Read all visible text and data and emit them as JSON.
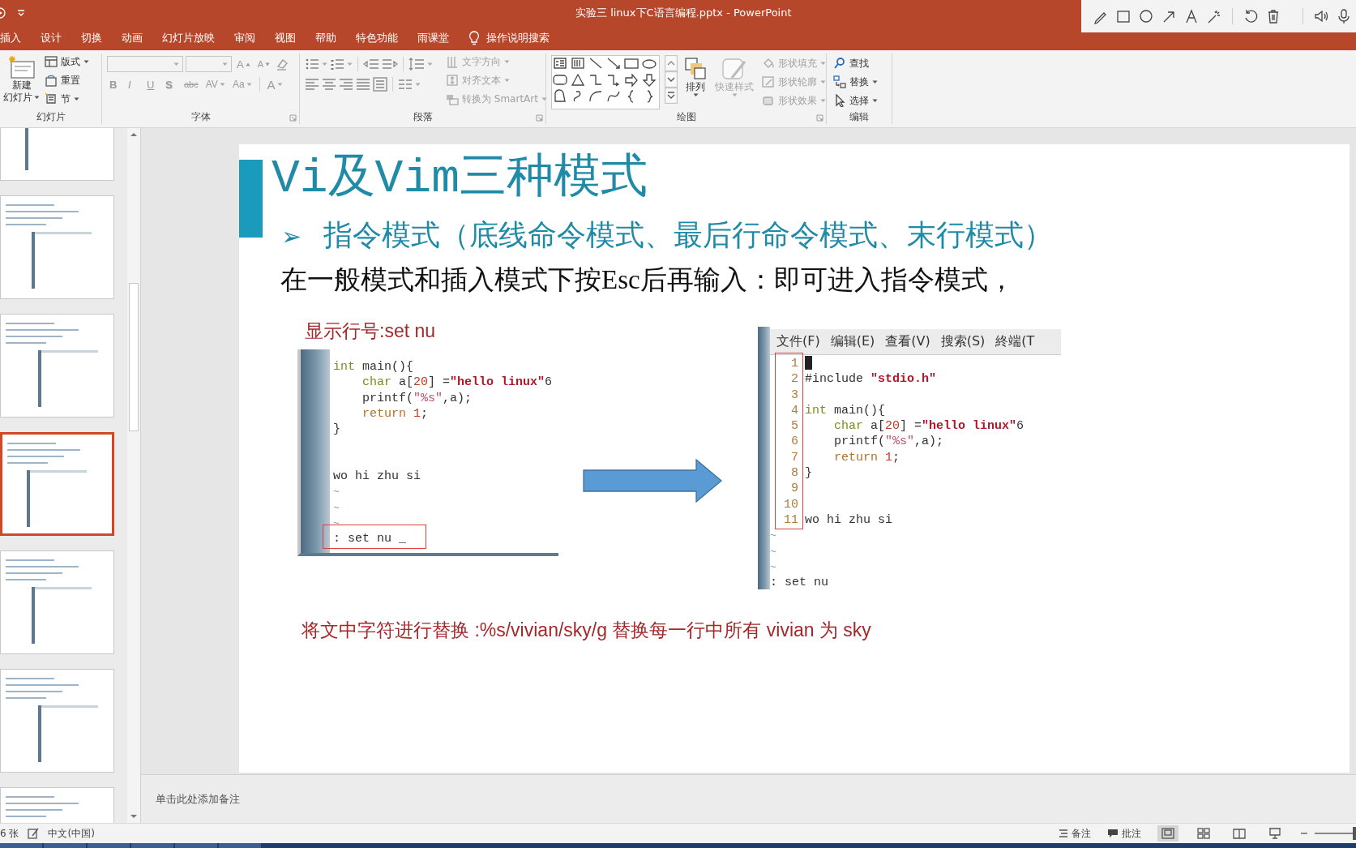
{
  "title_bar": {
    "title": "实验三  linux下C语言编程.pptx  -  PowerPoint"
  },
  "ribbon_tabs": [
    {
      "label": "插入",
      "selected": false
    },
    {
      "label": "设计",
      "selected": false
    },
    {
      "label": "切换",
      "selected": false
    },
    {
      "label": "动画",
      "selected": false
    },
    {
      "label": "幻灯片放映",
      "selected": false
    },
    {
      "label": "审阅",
      "selected": false
    },
    {
      "label": "视图",
      "selected": false
    },
    {
      "label": "帮助",
      "selected": false
    },
    {
      "label": "特色功能",
      "selected": false
    },
    {
      "label": "雨课堂",
      "selected": false
    }
  ],
  "tell_me": {
    "label": "操作说明搜索"
  },
  "ribbon": {
    "groups": [
      {
        "kind": "slides",
        "label": "幻灯片",
        "new_slide": {
          "label": "新建",
          "sublabel": "幻灯片"
        },
        "items": [
          {
            "label": "版式",
            "dropdown": true
          },
          {
            "label": "重置",
            "dropdown": false
          },
          {
            "label": "节",
            "dropdown": true
          }
        ]
      },
      {
        "kind": "font",
        "label": "字体",
        "disabled": true,
        "format_buttons": [
          "B",
          "I",
          "U",
          "S",
          "abc",
          "AV",
          "Aa"
        ],
        "grow_button": "A",
        "shrink_button": "A",
        "color_button": "A"
      },
      {
        "kind": "paragraph",
        "label": "段落",
        "items": [
          {
            "label": "文字方向",
            "disabled": true
          },
          {
            "label": "对齐文本",
            "disabled": true
          },
          {
            "label": "转换为 SmartArt",
            "disabled": true
          }
        ]
      },
      {
        "kind": "drawing",
        "label": "绘图",
        "arrange": {
          "label": "排列",
          "disabled": false
        },
        "quick_styles": {
          "label": "快速样式",
          "disabled": true
        },
        "items": [
          {
            "label": "形状填充",
            "disabled": true
          },
          {
            "label": "形状轮廓",
            "disabled": true
          },
          {
            "label": "形状效果",
            "disabled": true
          }
        ]
      },
      {
        "kind": "editing",
        "label": "编辑",
        "items": [
          {
            "label": "查找",
            "dropdown": false
          },
          {
            "label": "替换",
            "dropdown": true
          },
          {
            "label": "选择",
            "dropdown": true
          }
        ]
      }
    ]
  },
  "thumbnails": [
    {
      "selected": false
    },
    {
      "selected": false
    },
    {
      "selected": false
    },
    {
      "selected": true
    },
    {
      "selected": false
    },
    {
      "selected": false
    },
    {
      "selected": false
    }
  ],
  "slide": {
    "title": "Vi及Vim三种模式",
    "bullet_marker": "➢",
    "bullet": "指令模式（底线命令模式、最后行命令模式、末行模式）",
    "body": "在一般模式和插入模式下按Esc后再输入：即可进入指令模式，",
    "caption": "显示行号:set nu",
    "left_terminal": {
      "lines": [
        {
          "kind": "code",
          "tokens": [
            {
              "text": "int",
              "kind": "type"
            },
            {
              "text": " main(){",
              "kind": "plain"
            }
          ]
        },
        {
          "kind": "code",
          "tokens": [
            {
              "text": "    char",
              "kind": "type"
            },
            {
              "text": " a[",
              "kind": "plain"
            },
            {
              "text": "20",
              "kind": "number"
            },
            {
              "text": "] =",
              "kind": "plain"
            },
            {
              "text": "\"hello linux\"",
              "kind": "string"
            },
            {
              "text": "6",
              "kind": "plain"
            }
          ]
        },
        {
          "kind": "code",
          "tokens": [
            {
              "text": "    printf(",
              "kind": "plain"
            },
            {
              "text": "\"%s\"",
              "kind": "format"
            },
            {
              "text": ",a);",
              "kind": "plain"
            }
          ]
        },
        {
          "kind": "code",
          "tokens": [
            {
              "text": "    return",
              "kind": "keyword"
            },
            {
              "text": " 1",
              "kind": "number"
            },
            {
              "text": ";",
              "kind": "plain"
            }
          ]
        },
        {
          "kind": "code",
          "tokens": [
            {
              "text": "}",
              "kind": "plain"
            }
          ]
        },
        {
          "kind": "blank"
        },
        {
          "kind": "blank"
        },
        {
          "kind": "code",
          "tokens": [
            {
              "text": "wo hi zhu si",
              "kind": "plain"
            }
          ]
        },
        {
          "kind": "tilde",
          "text": "~"
        },
        {
          "kind": "tilde",
          "text": "~"
        },
        {
          "kind": "tilde",
          "text": "~"
        },
        {
          "kind": "command",
          "text": ": set nu _"
        }
      ]
    },
    "right_terminal": {
      "menu": [
        "文件(F)",
        "编辑(E)",
        "查看(V)",
        "搜索(S)",
        "終端(T"
      ],
      "lines": [
        {
          "kind": "code",
          "number": "1",
          "cursor": true
        },
        {
          "kind": "code",
          "number": "2",
          "cursor": false,
          "tokens": [
            {
              "text": "#include ",
              "kind": "plain"
            },
            {
              "text": "\"stdio.h\"",
              "kind": "string"
            }
          ]
        },
        {
          "kind": "blank",
          "number": "3",
          "cursor": false
        },
        {
          "kind": "code",
          "number": "4",
          "cursor": false,
          "tokens": [
            {
              "text": "int",
              "kind": "type"
            },
            {
              "text": " main(){",
              "kind": "plain"
            }
          ]
        },
        {
          "kind": "code",
          "number": "5",
          "cursor": false,
          "tokens": [
            {
              "text": "    char",
              "kind": "type"
            },
            {
              "text": " a[",
              "kind": "plain"
            },
            {
              "text": "20",
              "kind": "number"
            },
            {
              "text": "] =",
              "kind": "plain"
            },
            {
              "text": "\"hello linux\"",
              "kind": "string"
            },
            {
              "text": "6",
              "kind": "plain"
            }
          ]
        },
        {
          "kind": "code",
          "number": "6",
          "cursor": false,
          "tokens": [
            {
              "text": "    printf(",
              "kind": "plain"
            },
            {
              "text": "\"%s\"",
              "kind": "format"
            },
            {
              "text": ",a);",
              "kind": "plain"
            }
          ]
        },
        {
          "kind": "code",
          "number": "7",
          "cursor": false,
          "tokens": [
            {
              "text": "    return",
              "kind": "keyword"
            },
            {
              "text": " 1",
              "kind": "number"
            },
            {
              "text": ";",
              "kind": "plain"
            }
          ]
        },
        {
          "kind": "code",
          "number": "8",
          "cursor": false,
          "tokens": [
            {
              "text": "}",
              "kind": "plain"
            }
          ]
        },
        {
          "kind": "blank",
          "number": "9",
          "cursor": false
        },
        {
          "kind": "blank",
          "number": "10",
          "cursor": false
        },
        {
          "kind": "code",
          "number": "11",
          "cursor": false,
          "tokens": [
            {
              "text": "wo hi zhu si",
              "kind": "plain"
            }
          ]
        },
        {
          "kind": "tilde",
          "text": "~"
        },
        {
          "kind": "tilde",
          "text": "~"
        },
        {
          "kind": "tilde",
          "text": "~"
        },
        {
          "kind": "command",
          "text": ": set nu"
        }
      ]
    },
    "footer": "将文中字符进行替换 :%s/vivian/sky/g  替换每一行中所有 vivian 为 sky"
  },
  "notes": {
    "text": "单击此处添加备注"
  },
  "status_bar": {
    "slide_count": "6 张",
    "language": "中文(中国)",
    "notes_button": "备注",
    "comments_button": "批注",
    "views": [
      {
        "selected": true
      },
      {
        "selected": false
      },
      {
        "selected": false
      },
      {
        "selected": false
      }
    ],
    "zoom": {
      "level": 0.76
    }
  }
}
